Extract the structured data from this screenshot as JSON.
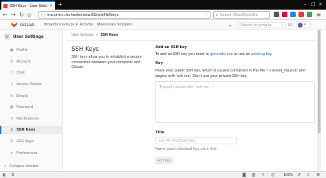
{
  "browser": {
    "tab_title": "SSH Keys · User Settings",
    "new_tab": "+",
    "url": "rna.urmc.rochester.edu:81/profile/keys",
    "search_placeholder": "Search DuckDuckGo",
    "zoom": "100%"
  },
  "gitlab": {
    "brand": "GitLab",
    "menu": [
      "Projects ▾",
      "Groups ▾",
      "Activity",
      "Milestones",
      "Snippets"
    ],
    "search_placeholder": "Search or jump to...",
    "brand_color": "#e24329"
  },
  "sidebar": {
    "title": "User Settings",
    "items": [
      {
        "label": "Profile",
        "icon": "person-icon"
      },
      {
        "label": "Account",
        "icon": "gear-icon"
      },
      {
        "label": "Chat",
        "icon": "chat-icon"
      },
      {
        "label": "Access Tokens",
        "icon": "key-icon"
      },
      {
        "label": "Emails",
        "icon": "envelope-icon"
      },
      {
        "label": "Password",
        "icon": "lock-icon"
      },
      {
        "label": "Notifications",
        "icon": "bell-icon"
      },
      {
        "label": "SSH Keys",
        "icon": "ssh-key-icon",
        "active": true
      },
      {
        "label": "GPG Keys",
        "icon": "gpg-key-icon"
      },
      {
        "label": "Preferences",
        "icon": "sliders-icon"
      }
    ],
    "collapse": "Collapse sidebar"
  },
  "breadcrumb": {
    "parent": "User Settings",
    "separator": ">",
    "current": "SSH Keys"
  },
  "page": {
    "heading": "SSH Keys",
    "description": "SSH keys allow you to establish a secure connection between your computer and GitLab.",
    "add_heading": "Add an SSH key",
    "add_text_before": "To add an SSH key you need to ",
    "generate_link": "generate one",
    "add_text_mid": " or use an ",
    "existing_link": "existing key",
    "add_text_after": ".",
    "key_label": "Key",
    "key_help": "Paste your public SSH key, which is usually contained in the file '~/.ssh/id_rsa.pub' and begins with 'ssh-rsa'. Don't use your private SSH key.",
    "key_placeholder": "Typically starts with \"ssh-rsa ...\"",
    "title_label": "Title",
    "title_placeholder": "e.g. My MacBook key",
    "title_help": "Name your individual key via a title",
    "add_button": "Add key",
    "link_color": "#1b69b6",
    "active_accent": "#1f78d1"
  }
}
